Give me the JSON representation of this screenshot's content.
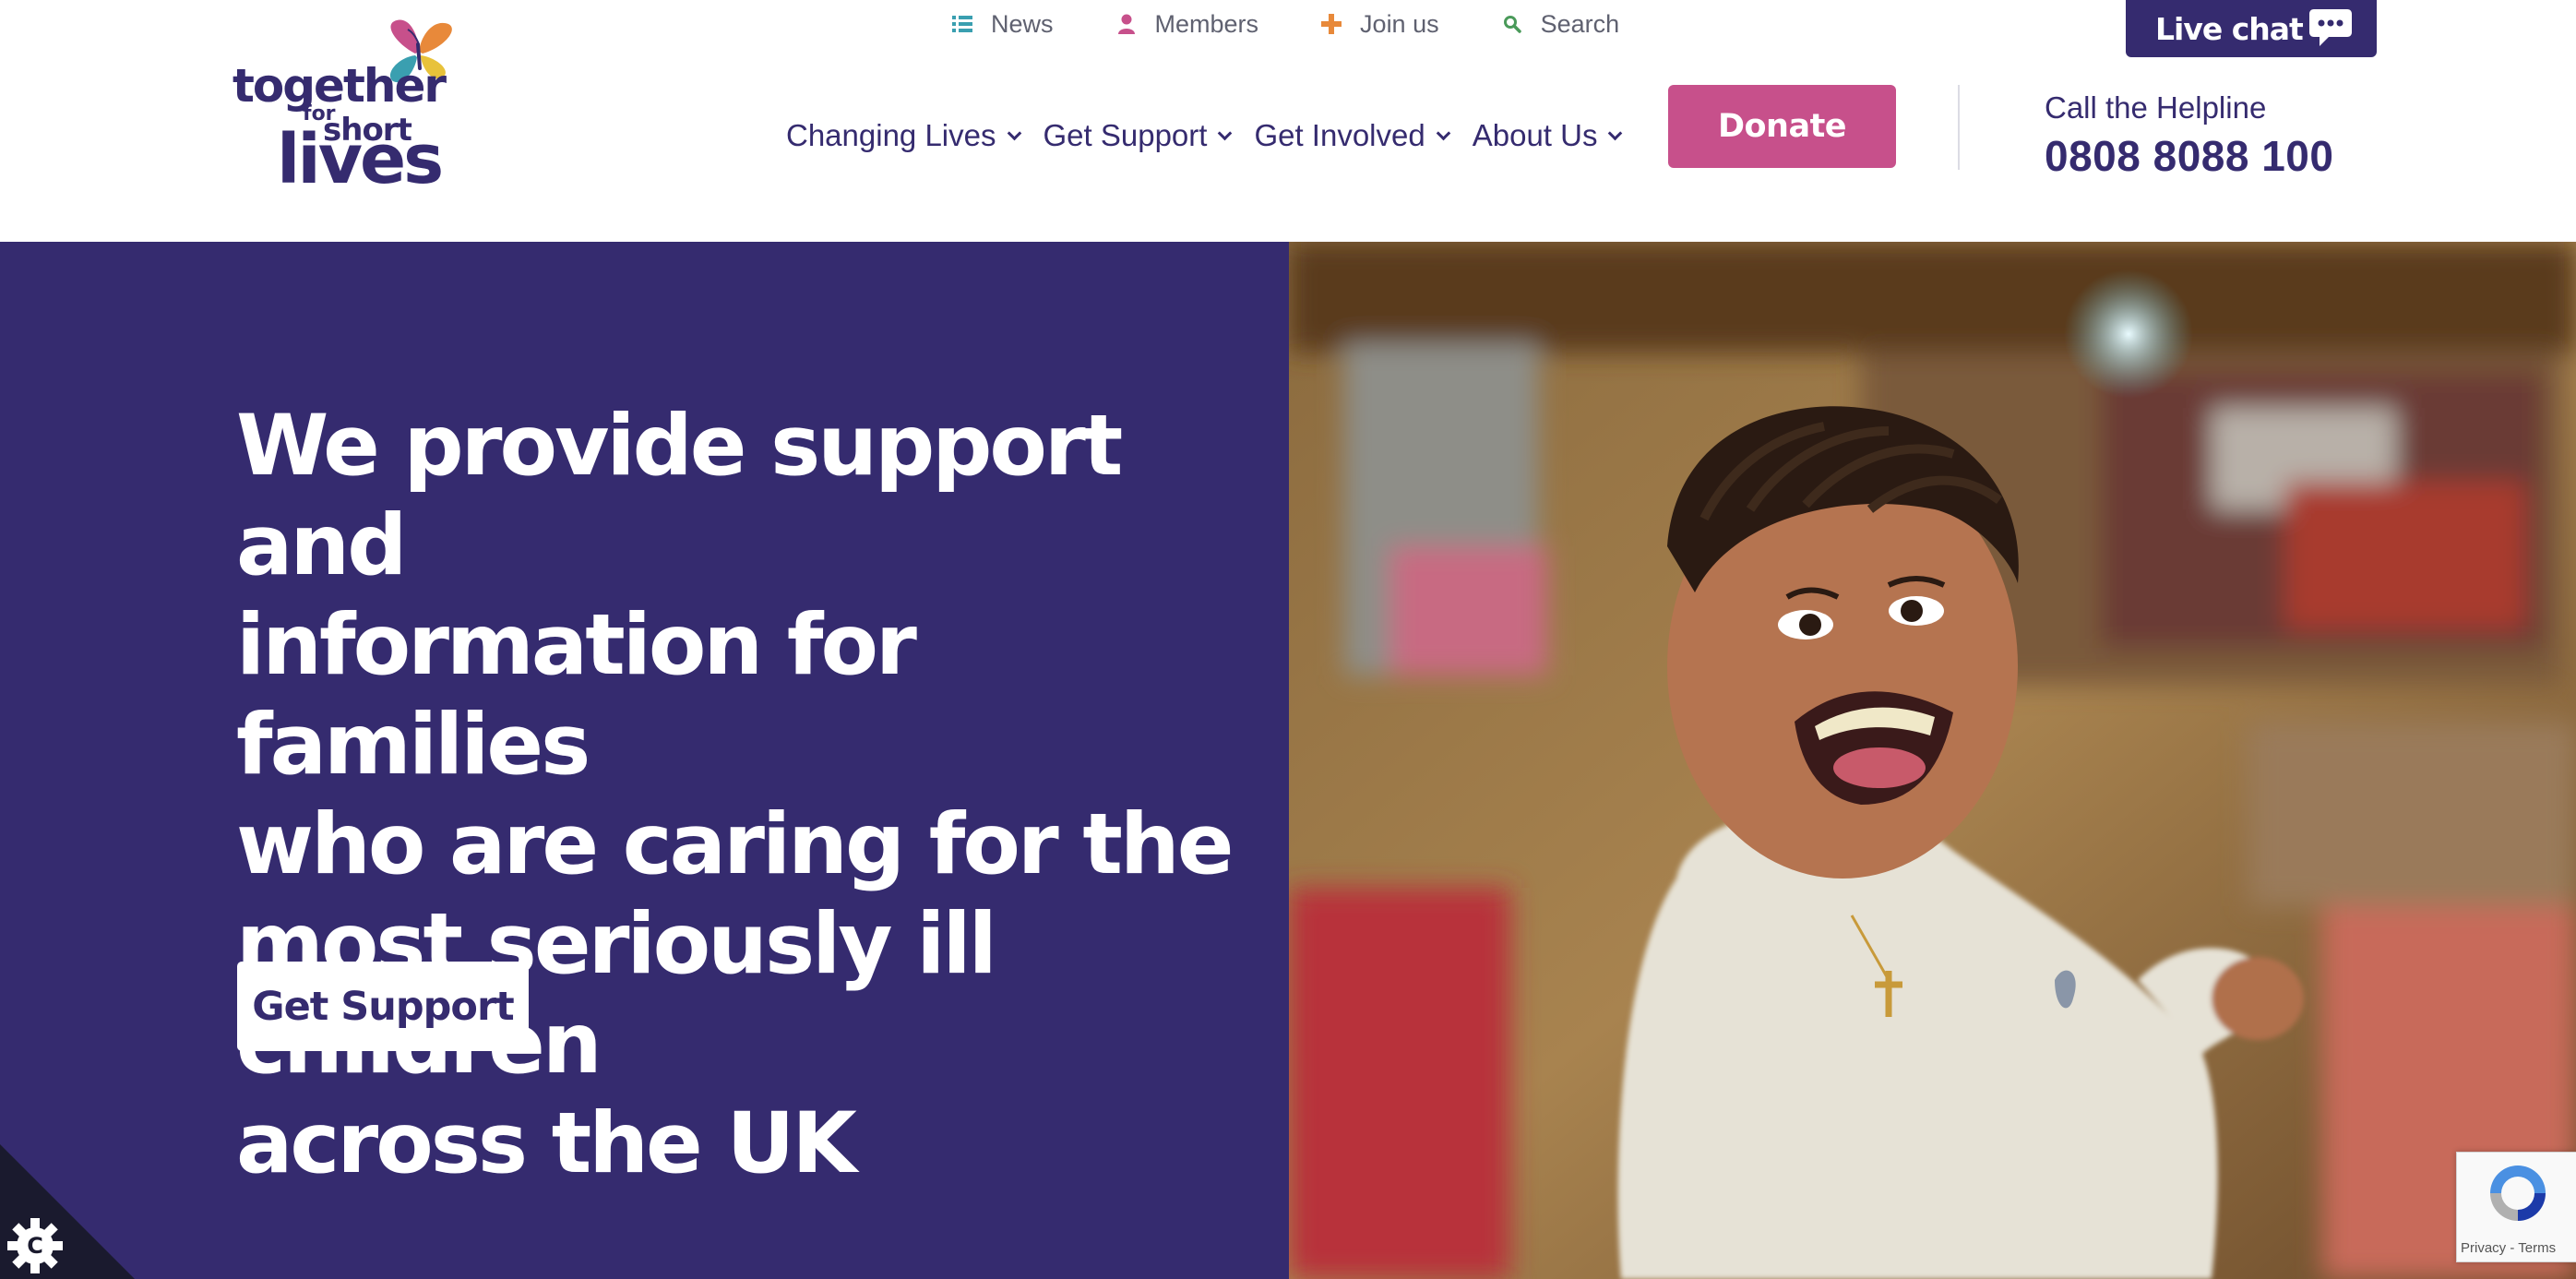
{
  "logo": {
    "word_together": "together",
    "word_for": "for",
    "word_short": "short",
    "word_lives": "lives"
  },
  "utility_nav": [
    {
      "label": "News",
      "icon": "list-icon",
      "color": "#3a9fb0"
    },
    {
      "label": "Members",
      "icon": "person-icon",
      "color": "#c7508b"
    },
    {
      "label": "Join us",
      "icon": "plus-icon",
      "color": "#e8893a"
    },
    {
      "label": "Search",
      "icon": "search-icon",
      "color": "#4a9a5a"
    }
  ],
  "live_chat": {
    "label": "Live chat",
    "icon": "speech-bubble-icon"
  },
  "main_nav": [
    {
      "label": "Changing Lives"
    },
    {
      "label": "Get Support"
    },
    {
      "label": "Get Involved"
    },
    {
      "label": "About Us"
    }
  ],
  "donate": {
    "label": "Donate"
  },
  "helpline": {
    "label": "Call the Helpline",
    "number": "0808 8088 100"
  },
  "hero": {
    "lines": [
      "We provide support and",
      "information for families",
      "who are caring for the",
      "most seriously ill children",
      "across the UK"
    ],
    "cta": "Get Support"
  },
  "recaptcha": {
    "privacy": "Privacy",
    "separator": " - ",
    "terms": "Terms"
  },
  "colors": {
    "brand_purple": "#352b6f",
    "donate_pink": "#c7508b",
    "white": "#ffffff"
  }
}
